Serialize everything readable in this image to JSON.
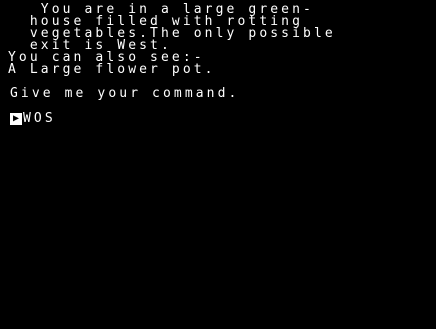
{
  "narrative": {
    "lines": [
      "   You are in a large green-",
      "  house filled with rotting",
      "  vegetables.The only possible",
      "  exit is West.",
      "You can also see:-",
      "A Large flower pot."
    ],
    "prompt": "Give me your command."
  },
  "input": {
    "cursor_glyph": "▶",
    "value": "WOS"
  },
  "colors": {
    "background": "#000000",
    "text": "#ffffff"
  }
}
